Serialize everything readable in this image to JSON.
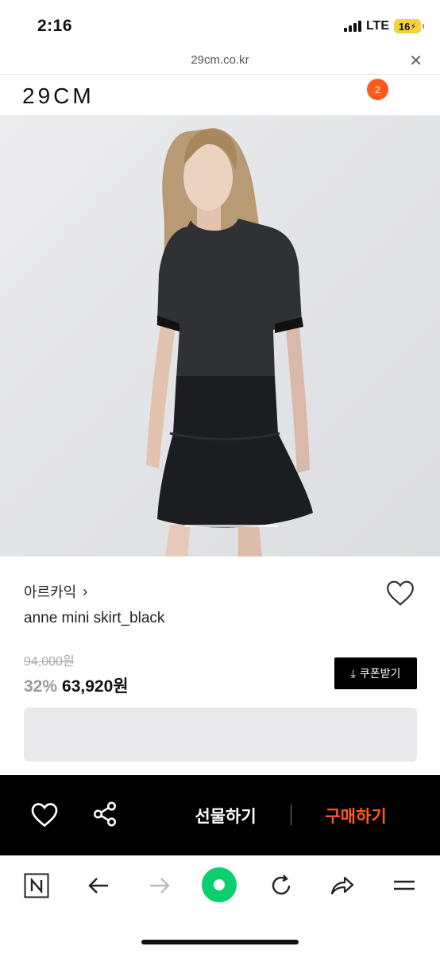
{
  "status_bar": {
    "time": "2:16",
    "network": "LTE",
    "battery": "16"
  },
  "url_bar": {
    "url": "29cm.co.kr",
    "close_icon": "close-icon"
  },
  "header": {
    "logo": "29CM",
    "cart_count": "2"
  },
  "product": {
    "brand": "아르카익",
    "brand_chevron": "›",
    "name": "anne mini skirt_black",
    "original_price": "94,000원",
    "discount": "32%",
    "sale_price": "63,920원",
    "coupon_label": "쿠폰받기"
  },
  "action_bar": {
    "gift_label": "선물하기",
    "buy_label": "구매하기"
  },
  "browser_toolbar": {
    "icons": [
      "naver-n-icon",
      "back-arrow-icon",
      "forward-arrow-icon",
      "green-home-icon",
      "reload-icon",
      "share-icon",
      "menu-icon"
    ]
  },
  "colors": {
    "accent": "#ff5a1a",
    "action_bar_bg": "#000000",
    "home_button": "#0ccf6f"
  }
}
